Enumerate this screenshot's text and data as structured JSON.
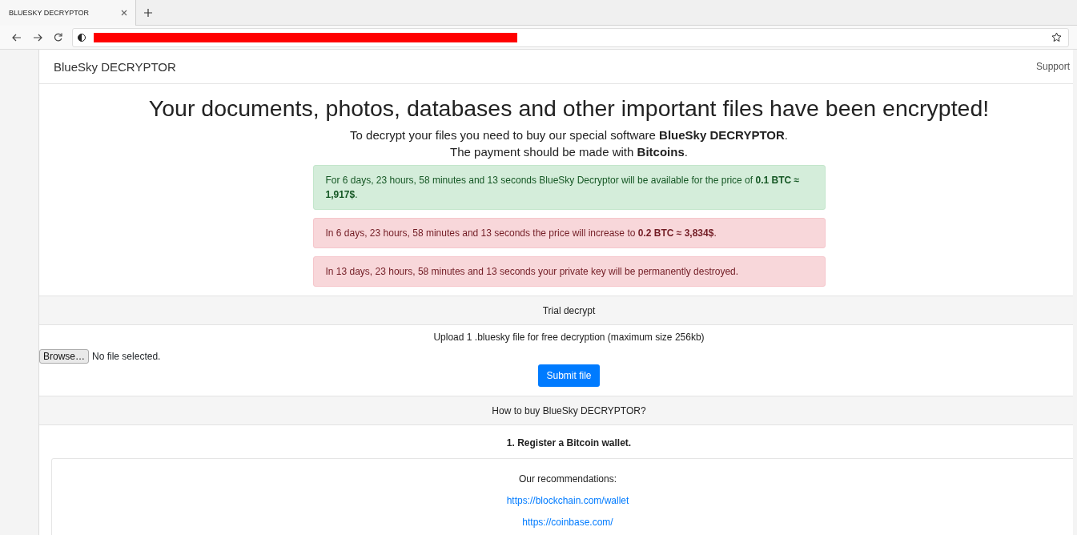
{
  "browser": {
    "tab": {
      "title": "BLUESKY DECRYPTOR",
      "selected": true
    },
    "address_bar": {
      "redacted": true
    }
  },
  "navbar": {
    "brand": "BlueSky DECRYPTOR",
    "links": [
      "Support"
    ]
  },
  "headline": "Your documents, photos, databases and other important files have been encrypted!",
  "intro": [
    "To decrypt your files you need to buy our special software **BlueSky DECRYPTOR**.",
    "The payment should be made with **Bitcoins**."
  ],
  "alerts": [
    {
      "kind": "success",
      "text": "For 6 days, 23 hours, 58 minutes and 13 seconds BlueSky Decryptor will be available for the price of **0.1 BTC ≈ 1,917$**."
    },
    {
      "kind": "danger",
      "text": "In 6 days, 23 hours, 58 minutes and 13 seconds the price will increase to **0.2 BTC ≈ 3,834$**."
    },
    {
      "kind": "danger",
      "text": "In 13 days, 23 hours, 58 minutes and 13 seconds your private key will be permanently destroyed."
    }
  ],
  "trial": {
    "header": "Trial decrypt",
    "instructions": "Upload 1 .bluesky file for free decryption (maximum size 256kb)",
    "browse_button": "Browse…",
    "file_status": "No file selected.",
    "submit_button": "Submit file"
  },
  "how_to_buy": {
    "header": "How to buy BlueSky DECRYPTOR?",
    "step": "1. Register a Bitcoin wallet.",
    "recommendations_title": "Our recommendations:",
    "links": [
      "https://blockchain.com/wallet",
      "https://coinbase.com/"
    ]
  }
}
